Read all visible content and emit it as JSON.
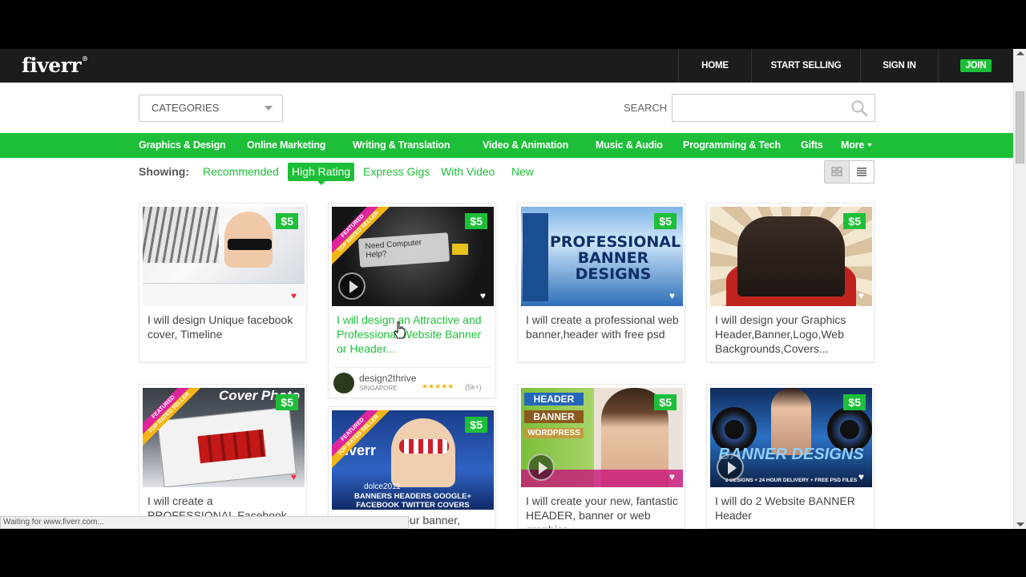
{
  "header": {
    "logo": "fiverr",
    "nav": [
      "HOME",
      "START SELLING",
      "SIGN IN"
    ],
    "join": "JOIN"
  },
  "search": {
    "categories_label": "CATEGORIES",
    "search_label": "SEARCH",
    "placeholder": ""
  },
  "categories": [
    "Graphics & Design",
    "Online Marketing",
    "Writing & Translation",
    "Video & Animation",
    "Music & Audio",
    "Programming & Tech",
    "Gifts",
    "More"
  ],
  "showing": {
    "label": "Showing:",
    "filters": [
      "Recommended",
      "High Rating",
      "Express Gigs",
      "With Video",
      "New"
    ],
    "active": "High Rating"
  },
  "ribbon": {
    "featured": "FEATURED",
    "top_rated": "TOP RATED SELLER"
  },
  "gigs": [
    {
      "title": "I will design Unique facebook cover, Timeline",
      "price": "$5"
    },
    {
      "title": "I will design an Attractive and Professional Website Banner or Header...",
      "price": "$5",
      "seller": "design2thrive",
      "country": "SINGAPORE",
      "stars": "★★★★★",
      "rating_count": "(5k+)"
    },
    {
      "title": "I will create a professional web banner,header with free psd",
      "price": "$5"
    },
    {
      "title": "I will design your Graphics Header,Banner,Logo,Web Backgrounds,Covers...",
      "price": "$5"
    },
    {
      "title": "I will create a PROFESSIONAL Facebook",
      "price": "$5"
    },
    {
      "title": "I will design your banner,",
      "price": "$5"
    },
    {
      "title": "I will create your new, fantastic HEADER, banner or web graphics",
      "price": "$5"
    },
    {
      "title": "I will do 2 Website BANNER Header",
      "price": "$5"
    }
  ],
  "thumb_text": {
    "banner_designs": "PROFESSIONAL BANNER DESIGNS",
    "need_help": "Need Computer Help?",
    "header_tags": [
      "HEADER",
      "BANNER",
      "WORDPRESS"
    ],
    "banner_headers": "BANNERS HEADERS GOOGLE+ FACEBOOK TWITTER COVERS",
    "cover_photo": "Cover Photo",
    "banner_designs2": "BANNER DESIGNS",
    "banner_sub": "2 DESIGNS + 24 HOUR DELIVERY + FREE PSD FILES",
    "dolce": "dolce2011",
    "fiverr_mark": "fiverr"
  },
  "status_text": "Waiting for www.fiverr.com...",
  "colors": {
    "brand_green": "#1dbf38",
    "header_bg": "#1c1c1c"
  }
}
